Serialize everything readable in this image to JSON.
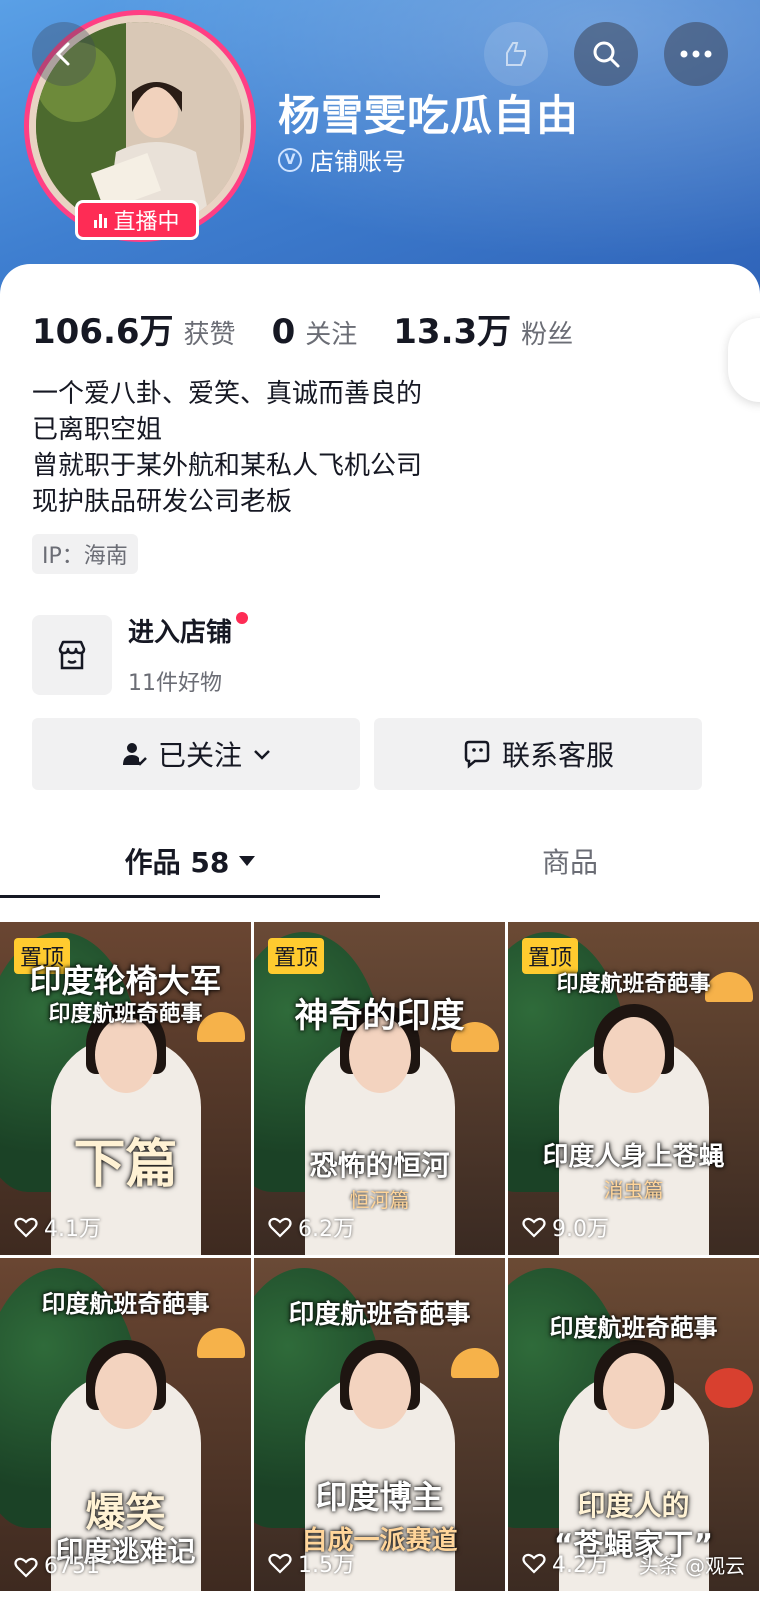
{
  "header": {
    "name": "杨雪雯吃瓜自由",
    "account_type": "店铺账号",
    "live_badge": "直播中",
    "gradient_colors": [
      "#5aa0e6",
      "#2f63b8"
    ]
  },
  "stats": [
    {
      "value": "106.6万",
      "label": "获赞"
    },
    {
      "value": "0",
      "label": "关注"
    },
    {
      "value": "13.3万",
      "label": "粉丝"
    }
  ],
  "bio": [
    "一个爱八卦、爱笑、真诚而善良的",
    "已离职空姐",
    "曾就职于某外航和某私人飞机公司",
    "现护肤品研发公司老板"
  ],
  "ip": "IP：海南",
  "shop": {
    "title": "进入店铺",
    "subtitle": "11件好物"
  },
  "actions": {
    "follow": "已关注",
    "contact": "联系客服"
  },
  "tabs": {
    "works": "作品 58",
    "goods": "商品"
  },
  "videos": [
    {
      "pinned": "置顶",
      "top": "印度轮椅大军",
      "top2": "印度航班奇葩事",
      "mid": "下篇",
      "sub": "",
      "likes": "4.1万"
    },
    {
      "pinned": "置顶",
      "top": "神奇的印度",
      "top2": "",
      "mid": "恐怖的恒河",
      "sub": "恒河篇",
      "likes": "6.2万"
    },
    {
      "pinned": "置顶",
      "top": "",
      "top2": "印度航班奇葩事",
      "mid": "印度人身上苍蝇",
      "sub": "消虫篇",
      "likes": "9.0万"
    },
    {
      "pinned": "",
      "top": "",
      "top2": "印度航班奇葩事",
      "mid": "爆笑",
      "sub": "印度逃难记",
      "likes": "6751"
    },
    {
      "pinned": "",
      "top": "",
      "top2": "印度航班奇葩事",
      "mid": "印度博主",
      "sub": "自成一派赛道",
      "likes": "1.5万"
    },
    {
      "pinned": "",
      "top": "",
      "top2": "印度航班奇葩事",
      "mid": "印度人的",
      "sub": "“苍蝇家丁”",
      "likes": "4.2万"
    }
  ],
  "watermark": "头条 @观云",
  "accent": "#fe2c55",
  "pin_color": "#ffcb2f"
}
